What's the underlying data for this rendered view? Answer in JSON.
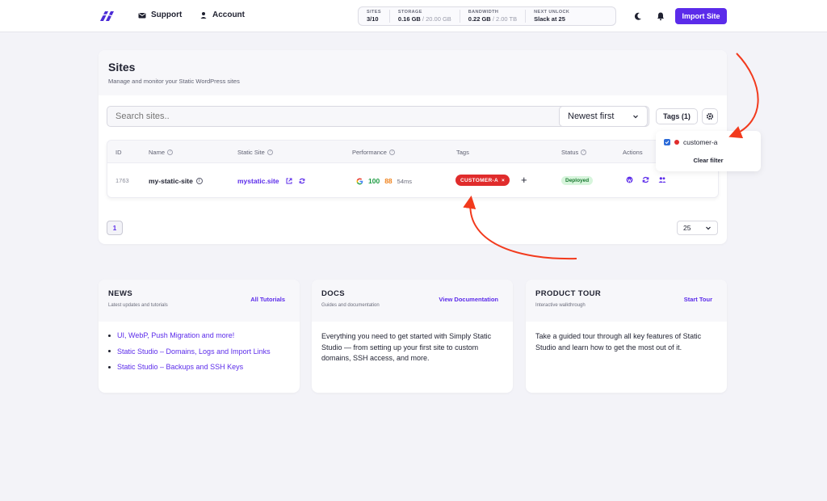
{
  "nav": {
    "support_label": "Support",
    "account_label": "Account",
    "import_label": "Import Site"
  },
  "stats": [
    {
      "label": "SITES",
      "value": "3/10",
      "extra": ""
    },
    {
      "label": "STORAGE",
      "value": "0.16 GB",
      "extra": " / 20.00 GB"
    },
    {
      "label": "BANDWIDTH",
      "value": "0.22 GB",
      "extra": " / 2.00 TB"
    },
    {
      "label": "NEXT UNLOCK",
      "value": "Slack at 25",
      "extra": ""
    }
  ],
  "sites": {
    "title": "Sites",
    "subtitle": "Manage and monitor your Static WordPress sites",
    "search_placeholder": "Search sites..",
    "sort_value": "Newest first",
    "tags_label": "Tags (1)",
    "columns": [
      "ID",
      "Name",
      "Static Site",
      "Performance",
      "Tags",
      "Status",
      "Actions"
    ],
    "row": {
      "id": "1763",
      "name": "my-static-site",
      "static_site": "mystatic.site",
      "perf_desktop": "100",
      "perf_mobile": "88",
      "perf_time": "54ms",
      "tag": "CUSTOMER-A",
      "tag_remove": "×",
      "add_tag": "+",
      "status": "Deployed"
    },
    "page": "1",
    "per_page": "25"
  },
  "tag_filter": {
    "item_label": "customer-a",
    "clear_label": "Clear filter"
  },
  "news": {
    "title": "NEWS",
    "subtitle": "Latest updates and tutorials",
    "link": "All Tutorials",
    "items": [
      "UI, WebP, Push Migration and more!",
      "Static Studio – Domains, Logs and Import Links",
      "Static Studio – Backups and SSH Keys"
    ]
  },
  "docs": {
    "title": "DOCS",
    "subtitle": "Guides and documentation",
    "link": "View Documentation",
    "body": "Everything you need to get started with Simply Static Studio — from setting up your first site to custom domains, SSH access, and more."
  },
  "tour": {
    "title": "PRODUCT TOUR",
    "subtitle": "Interactive walkthrough",
    "link": "Start Tour",
    "body": "Take a guided tour through all key features of Static Studio and learn how to get the most out of it."
  },
  "colors": {
    "accent": "#5b2bea",
    "tag": "#e02c2c",
    "status": "#1c7a32",
    "annotation": "#f23a1d"
  }
}
